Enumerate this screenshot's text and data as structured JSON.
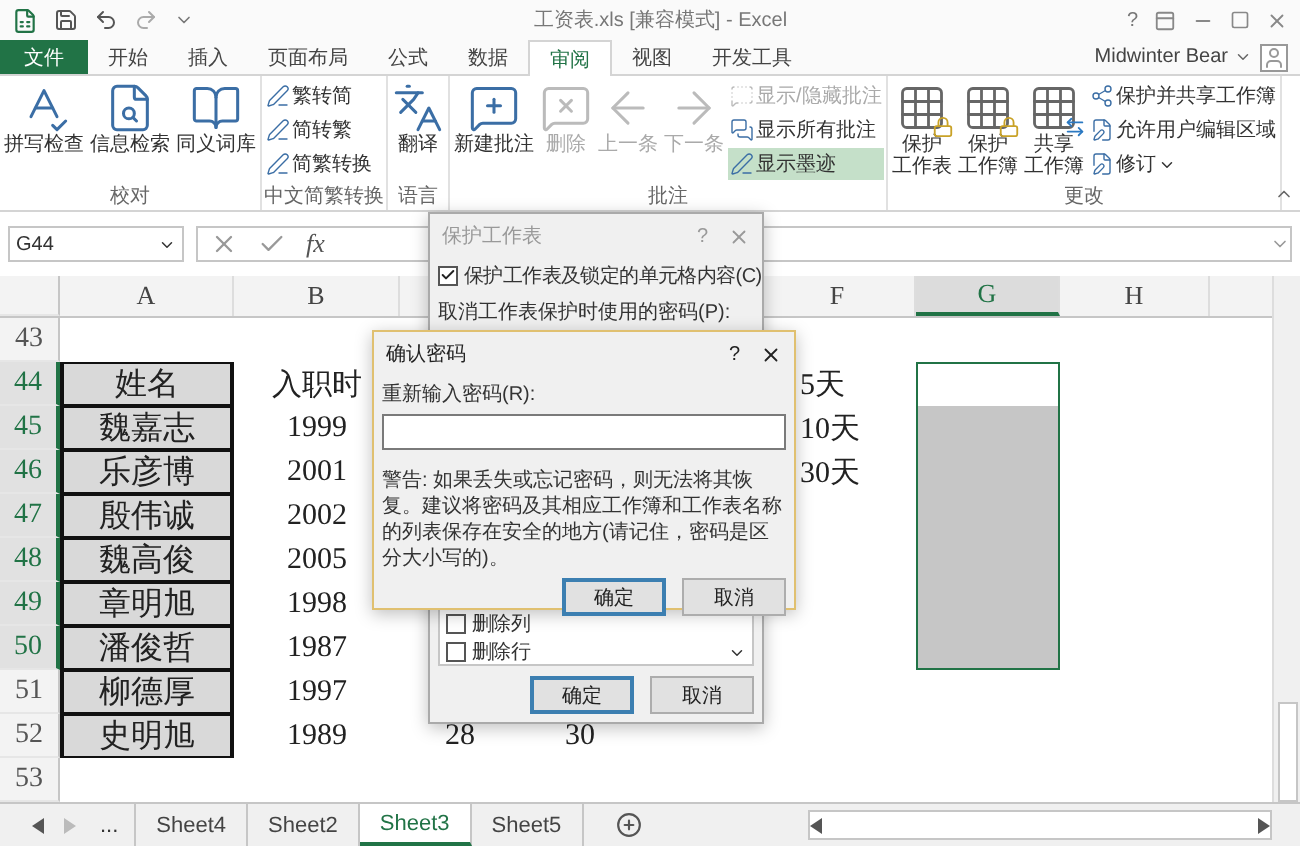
{
  "title_bar": {
    "title": "工资表.xls  [兼容模式] - Excel",
    "help": "?"
  },
  "ribbon_tabs": [
    {
      "label": "文件",
      "kind": "file",
      "selected": false
    },
    {
      "label": "开始",
      "kind": "tab",
      "selected": false
    },
    {
      "label": "插入",
      "kind": "tab",
      "selected": false
    },
    {
      "label": "页面布局",
      "kind": "tab",
      "selected": false
    },
    {
      "label": "公式",
      "kind": "tab",
      "selected": false
    },
    {
      "label": "数据",
      "kind": "tab",
      "selected": false
    },
    {
      "label": "审阅",
      "kind": "tab",
      "selected": true
    },
    {
      "label": "视图",
      "kind": "tab",
      "selected": false
    },
    {
      "label": "开发工具",
      "kind": "tab",
      "selected": false
    }
  ],
  "user": "Midwinter Bear",
  "ribbon_groups": [
    {
      "label": "校对",
      "items": [
        {
          "lines": [
            "拼写检查"
          ],
          "kind": "large",
          "disabled": false,
          "active": false
        },
        {
          "lines": [
            "信息检索"
          ],
          "kind": "large",
          "disabled": false,
          "active": false
        },
        {
          "lines": [
            "同义词库"
          ],
          "kind": "large",
          "disabled": false,
          "active": false
        }
      ]
    },
    {
      "label": "中文简繁转换",
      "items": [
        {
          "lines": [
            "繁转简"
          ],
          "kind": "small",
          "disabled": false,
          "active": false
        },
        {
          "lines": [
            "简转繁"
          ],
          "kind": "small",
          "disabled": false,
          "active": false
        },
        {
          "lines": [
            "简繁转换"
          ],
          "kind": "small",
          "disabled": false,
          "active": false
        }
      ]
    },
    {
      "label": "语言",
      "items": [
        {
          "lines": [
            "翻译"
          ],
          "kind": "large",
          "disabled": false,
          "active": false
        }
      ]
    },
    {
      "label": "批注",
      "items": [
        {
          "lines": [
            "新建批注"
          ],
          "kind": "large",
          "disabled": false,
          "active": false
        },
        {
          "lines": [
            "删除"
          ],
          "kind": "large",
          "disabled": true,
          "active": false
        },
        {
          "lines": [
            "上一条"
          ],
          "kind": "large",
          "disabled": true,
          "active": false
        },
        {
          "lines": [
            "下一条"
          ],
          "kind": "large",
          "disabled": true,
          "active": false
        },
        {
          "lines": [
            "显示/隐藏批注"
          ],
          "kind": "small",
          "disabled": true,
          "active": false
        },
        {
          "lines": [
            "显示所有批注"
          ],
          "kind": "small",
          "disabled": false,
          "active": false
        },
        {
          "lines": [
            "显示墨迹"
          ],
          "kind": "small",
          "disabled": false,
          "active": true
        }
      ]
    },
    {
      "label": "更改",
      "items": [
        {
          "lines": [
            "保护",
            "工作表"
          ],
          "kind": "large",
          "disabled": false,
          "active": false
        },
        {
          "lines": [
            "保护",
            "工作簿"
          ],
          "kind": "large",
          "disabled": false,
          "active": false
        },
        {
          "lines": [
            "共享",
            "工作簿"
          ],
          "kind": "large",
          "disabled": false,
          "active": false
        },
        {
          "lines": [
            "保护并共享工作簿"
          ],
          "kind": "small",
          "disabled": false,
          "active": false
        },
        {
          "lines": [
            "允许用户编辑区域"
          ],
          "kind": "small",
          "disabled": false,
          "active": false
        },
        {
          "lines": [
            "修订"
          ],
          "kind": "small",
          "disabled": false,
          "active": false,
          "dropdown": true
        }
      ]
    }
  ],
  "formula_bar": {
    "name_box": "G44",
    "function_label": "fx"
  },
  "sheet": {
    "columns": [
      {
        "label": "A",
        "selected": false
      },
      {
        "label": "B",
        "selected": false
      },
      {},
      {},
      {},
      {
        "label": "F",
        "selected": false
      },
      {
        "label": "G",
        "selected": true
      },
      {
        "label": "H",
        "selected": false
      }
    ],
    "rows": [
      {
        "header": "43",
        "selected": false,
        "boxed": false,
        "active": false,
        "in_selection": false,
        "cells": []
      },
      {
        "header": "44",
        "selected": true,
        "boxed": true,
        "active": true,
        "in_selection": true,
        "cells": [
          "姓名",
          "入职时",
          "",
          "",
          "",
          "5天"
        ]
      },
      {
        "header": "45",
        "selected": true,
        "boxed": true,
        "active": false,
        "in_selection": true,
        "cells": [
          "魏嘉志",
          "1999",
          "",
          "",
          "",
          "10天"
        ]
      },
      {
        "header": "46",
        "selected": true,
        "boxed": true,
        "active": false,
        "in_selection": true,
        "cells": [
          "乐彦博",
          "2001",
          "",
          "",
          "",
          "30天"
        ]
      },
      {
        "header": "47",
        "selected": true,
        "boxed": true,
        "active": false,
        "in_selection": true,
        "cells": [
          "殷伟诚",
          "2002"
        ]
      },
      {
        "header": "48",
        "selected": true,
        "boxed": true,
        "active": false,
        "in_selection": true,
        "cells": [
          "魏高俊",
          "2005"
        ]
      },
      {
        "header": "49",
        "selected": true,
        "boxed": true,
        "active": false,
        "in_selection": true,
        "cells": [
          "章明旭",
          "1998"
        ]
      },
      {
        "header": "50",
        "selected": true,
        "boxed": true,
        "active": false,
        "in_selection": true,
        "cells": [
          "潘俊哲",
          "1987"
        ]
      },
      {
        "header": "51",
        "selected": false,
        "boxed": true,
        "active": false,
        "in_selection": false,
        "cells": [
          "柳德厚",
          "1997"
        ]
      },
      {
        "header": "52",
        "selected": false,
        "boxed": true,
        "active": false,
        "in_selection": false,
        "cells": [
          "史明旭",
          "1989",
          "28",
          "30"
        ]
      },
      {
        "header": "53",
        "selected": false,
        "boxed": false,
        "active": false,
        "in_selection": false,
        "cells": []
      }
    ]
  },
  "protect_dialog": {
    "title": "保护工作表",
    "help": "?",
    "protect_option": {
      "label": "保护工作表及锁定的单元格内容(C)",
      "checked": true
    },
    "password_label": "取消工作表保护时使用的密码(P):",
    "permissions": [
      {
        "label": "删除列",
        "checked": false
      },
      {
        "label": "删除行",
        "checked": false
      }
    ],
    "buttons": [
      {
        "label": "确定",
        "default": true
      },
      {
        "label": "取消",
        "default": false
      }
    ]
  },
  "confirm_dialog": {
    "title": "确认密码",
    "help": "?",
    "field_label": "重新输入密码(R):",
    "warning": "警告: 如果丢失或忘记密码，则无法将其恢复。建议将密码及其相应工作簿和工作表名称的列表保存在安全的地方(请记住，密码是区分大小写的)。",
    "buttons": [
      {
        "label": "确定",
        "default": true
      },
      {
        "label": "取消",
        "default": false
      }
    ]
  },
  "sheet_tabs": {
    "more": "...",
    "tabs": [
      {
        "label": "Sheet4",
        "selected": false
      },
      {
        "label": "Sheet2",
        "selected": false
      },
      {
        "label": "Sheet3",
        "selected": true
      },
      {
        "label": "Sheet5",
        "selected": false
      }
    ]
  }
}
